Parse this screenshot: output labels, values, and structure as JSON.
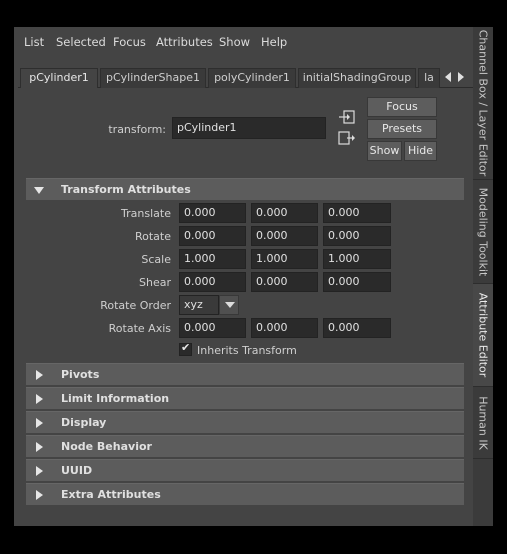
{
  "menu": [
    "List",
    "Selected",
    "Focus",
    "Attributes",
    "Show",
    "Help"
  ],
  "tabs": [
    "pCylinder1",
    "pCylinderShape1",
    "polyCylinder1",
    "initialShadingGroup",
    "la"
  ],
  "transform": {
    "label": "transform:",
    "value": "pCylinder1"
  },
  "buttons": {
    "focus": "Focus",
    "presets": "Presets",
    "show": "Show",
    "hide": "Hide"
  },
  "transform_section": {
    "title": "Transform Attributes",
    "translate": {
      "label": "Translate",
      "values": [
        "0.000",
        "0.000",
        "0.000"
      ]
    },
    "rotate": {
      "label": "Rotate",
      "values": [
        "0.000",
        "0.000",
        "0.000"
      ]
    },
    "scale": {
      "label": "Scale",
      "values": [
        "1.000",
        "1.000",
        "1.000"
      ]
    },
    "shear": {
      "label": "Shear",
      "values": [
        "0.000",
        "0.000",
        "0.000"
      ]
    },
    "rotate_order": {
      "label": "Rotate Order",
      "value": "xyz"
    },
    "rotate_axis": {
      "label": "Rotate Axis",
      "values": [
        "0.000",
        "0.000",
        "0.000"
      ]
    },
    "inherits": {
      "label": "Inherits Transform",
      "checked": true
    }
  },
  "collapsed_sections": [
    "Pivots",
    "Limit Information",
    "Display",
    "Node Behavior",
    "UUID",
    "Extra Attributes"
  ],
  "side_tabs": [
    "Channel Box / Layer Editor",
    "Modeling Toolkit",
    "Attribute Editor",
    "Human IK"
  ],
  "icons": {
    "tab_left": "chevron-left-icon",
    "tab_right": "chevron-right-icon",
    "load_selected": "input-connection-icon",
    "output_connection": "output-connection-icon",
    "dropdown": "chevron-down-icon",
    "check": "checkmark-icon"
  },
  "colors": {
    "panel": "#444444",
    "field": "#2a2a2a",
    "section_header": "#5c5c5c",
    "button": "#5d5d5d"
  }
}
